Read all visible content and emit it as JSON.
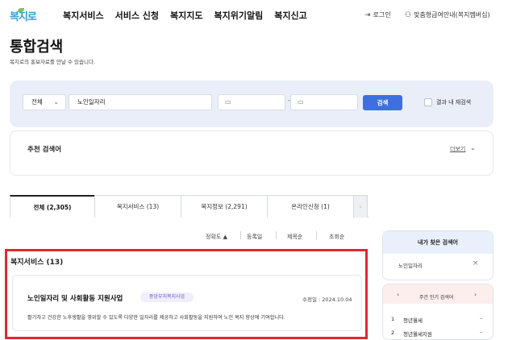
{
  "header": {
    "logo": "복지로",
    "nav": [
      "복지서비스",
      "서비스 신청",
      "복지지도",
      "복지위기알림",
      "복지신고"
    ],
    "login": "로그인",
    "custom": "맞춤형급여안내(복지멤버십)"
  },
  "page": {
    "title": "통합검색",
    "subtitle": "복지로의 홍보자료를 만날 수 있습니다."
  },
  "search": {
    "scope": "전체",
    "keyword": "노인일자리",
    "button": "검색",
    "within_label": "결과 내 재검색"
  },
  "recommended": {
    "title": "추천 검색어",
    "more": "더보기"
  },
  "tabs": [
    {
      "label": "전체 (2,305)"
    },
    {
      "label": "복지서비스 (13)"
    },
    {
      "label": "복지정보 (2,291)"
    },
    {
      "label": "온라인신청 (1)"
    }
  ],
  "sort": [
    "정확도",
    "등록일",
    "제목순",
    "조회순"
  ],
  "section": {
    "title": "복지서비스 (13)",
    "item": {
      "title": "노인일자리 및 사회활동 지원사업",
      "badge": "중앙부처복지사업",
      "modified": "수정일 : 2024.10.04",
      "desc": "활기차고 건강한 노후생활을 영위할 수 있도록 다양한 일자리를 제공하고 사회활동을 지원하여 노인 복지 향상에 기여합니다."
    }
  },
  "my_keywords": {
    "title": "내가 찾은 검색어",
    "items": [
      "노인일자리"
    ]
  },
  "popular": {
    "title": "주간 인기 검색어",
    "items": [
      {
        "rank": "1",
        "label": "청년월세",
        "change": "–"
      },
      {
        "rank": "2",
        "label": "청년월세지원",
        "change": "–"
      }
    ]
  },
  "colors": {
    "accent": "#3d6fe0",
    "highlight": "#e02a2a",
    "panel": "#e9eef8"
  }
}
